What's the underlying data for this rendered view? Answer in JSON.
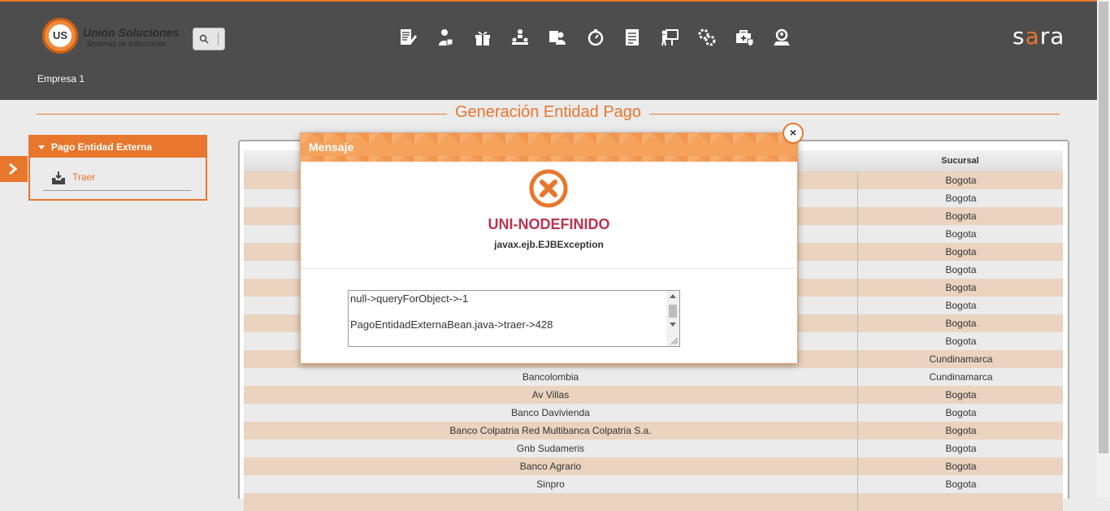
{
  "header": {
    "logo_name": "Unión Soluciones",
    "logo_sub": "Sistemas de Información",
    "logo_mark": "US",
    "company": "Empresa 1",
    "brand": "sara",
    "nav_icons": [
      "document-edit-icon",
      "user-chart-icon",
      "gift-icon",
      "org-chart-icon",
      "user-card-icon",
      "stopwatch-icon",
      "report-icon",
      "presentation-icon",
      "gears-icon",
      "medical-case-icon",
      "search-person-icon"
    ]
  },
  "page": {
    "title": "Generación Entidad Pago"
  },
  "menu": {
    "section": "Pago Entidad Externa",
    "items": [
      {
        "label": "Traer",
        "icon": "inbox-download-icon"
      }
    ]
  },
  "table": {
    "col_sucursal": "Sucursal",
    "rows": [
      {
        "entidad": "",
        "sucursal": "Bogota"
      },
      {
        "entidad": "",
        "sucursal": "Bogota"
      },
      {
        "entidad": "",
        "sucursal": "Bogota"
      },
      {
        "entidad": "",
        "sucursal": "Bogota"
      },
      {
        "entidad": "",
        "sucursal": "Bogota"
      },
      {
        "entidad": "",
        "sucursal": "Bogota"
      },
      {
        "entidad": "",
        "sucursal": "Bogota"
      },
      {
        "entidad": "",
        "sucursal": "Bogota"
      },
      {
        "entidad": "",
        "sucursal": "Bogota"
      },
      {
        "entidad": "",
        "sucursal": "Bogota"
      },
      {
        "entidad": "",
        "sucursal": "Cundinamarca"
      },
      {
        "entidad": "Bancolombia",
        "sucursal": "Cundinamarca"
      },
      {
        "entidad": "Av Villas",
        "sucursal": "Bogota"
      },
      {
        "entidad": "Banco Davivienda",
        "sucursal": "Bogota"
      },
      {
        "entidad": "Banco Colpatria Red Multibanca Colpatria S.a.",
        "sucursal": "Bogota"
      },
      {
        "entidad": "Gnb Sudameris",
        "sucursal": "Bogota"
      },
      {
        "entidad": "Banco Agrario",
        "sucursal": "Bogota"
      },
      {
        "entidad": "Sinpro",
        "sucursal": "Bogota"
      },
      {
        "entidad": "",
        "sucursal": ""
      }
    ]
  },
  "modal": {
    "title": "Mensaje",
    "code": "UNI-NODEFINIDO",
    "exception": "javax.ejb.EJBException",
    "detail_line1": "null->queryForObject->-1",
    "detail_line2": "PagoEntidadExternaBean.java->traer->428",
    "close_glyph": "×"
  },
  "colors": {
    "accent": "#e8762c",
    "header_bg": "#4d4d4d",
    "error_red": "#b83450",
    "row_odd": "#ead3bf"
  }
}
